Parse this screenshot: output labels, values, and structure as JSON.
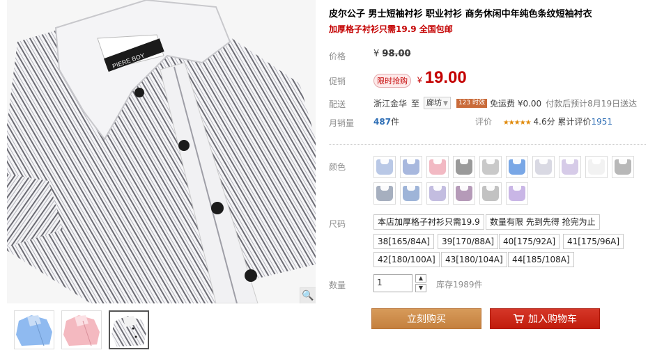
{
  "product": {
    "title": "皮尔公子 男士短袖衬衫 职业衬衫 商务休闲中年纯色条纹短袖衬衣",
    "subtitle": "加厚格子衬衫只需19.9 全国包邮",
    "brand_label_on_collar": "PIERE BOY"
  },
  "price": {
    "label": "价格",
    "currency": "¥",
    "original": "98.00"
  },
  "promo": {
    "label": "促销",
    "tag": "限时抢购",
    "currency": "¥",
    "price": "19.00"
  },
  "shipping": {
    "label": "配送",
    "from": "浙江金华",
    "to_word": "至",
    "destination": "廊坊",
    "badge": "123 时效",
    "fee": "免运费 ¥0.00",
    "eta": "付款后预计8月19日送达"
  },
  "sales": {
    "label": "月销量",
    "count": "487",
    "unit": "件"
  },
  "rating": {
    "label": "评价",
    "stars": "★★★★★",
    "score": "4.6分",
    "review_prefix": "累计评价",
    "review_count": "1951"
  },
  "colors": {
    "label": "颜色",
    "swatches": [
      {
        "name": "light-blue-stripe",
        "color": "#b9c8e6"
      },
      {
        "name": "blue-stripe",
        "color": "#a8b8de"
      },
      {
        "name": "pink-stripe",
        "color": "#f2b9c3"
      },
      {
        "name": "gray",
        "color": "#9a9a9a"
      },
      {
        "name": "gray-stripe",
        "color": "#c9c9c9"
      },
      {
        "name": "blue",
        "color": "#79a7e6"
      },
      {
        "name": "white-stripe",
        "color": "#d9d9e3"
      },
      {
        "name": "lavender-stripe",
        "color": "#d6cbe8"
      },
      {
        "name": "white",
        "color": "#f2f2f2"
      },
      {
        "name": "dark-gray-stripe",
        "color": "#b8b8b8"
      },
      {
        "name": "slate-stripe",
        "color": "#a6afbf"
      },
      {
        "name": "steel-blue",
        "color": "#9eb4d8"
      },
      {
        "name": "lilac-stripe",
        "color": "#c3bde0"
      },
      {
        "name": "mauve",
        "color": "#b59ab8"
      },
      {
        "name": "silver-stripe",
        "color": "#c2c2c2"
      },
      {
        "name": "violet-stripe",
        "color": "#c9b6e6"
      }
    ]
  },
  "sizes": {
    "label": "尺码",
    "options": [
      "本店加厚格子衬衫只需19.9",
      "数量有限 先到先得 抢完为止",
      "38[165/84A]",
      "39[170/88A]",
      "40[175/92A]",
      "41[175/96A]",
      "42[180/100A]",
      "43[180/104A]",
      "44[185/108A]"
    ]
  },
  "quantity": {
    "label": "数量",
    "value": "1",
    "stock": "库存1989件"
  },
  "actions": {
    "buy_now": "立刻购买",
    "add_to_cart": "加入购物车"
  },
  "thumbnails": [
    {
      "name": "blue-shirt",
      "color": "#8fbaf0"
    },
    {
      "name": "pink-shirt",
      "color": "#f4b9c0"
    },
    {
      "name": "striped-shirt",
      "color": "#b9b9b9"
    }
  ],
  "icons": {
    "zoom": "🔍",
    "cart": "cart-icon",
    "up": "▲",
    "down": "▼"
  }
}
